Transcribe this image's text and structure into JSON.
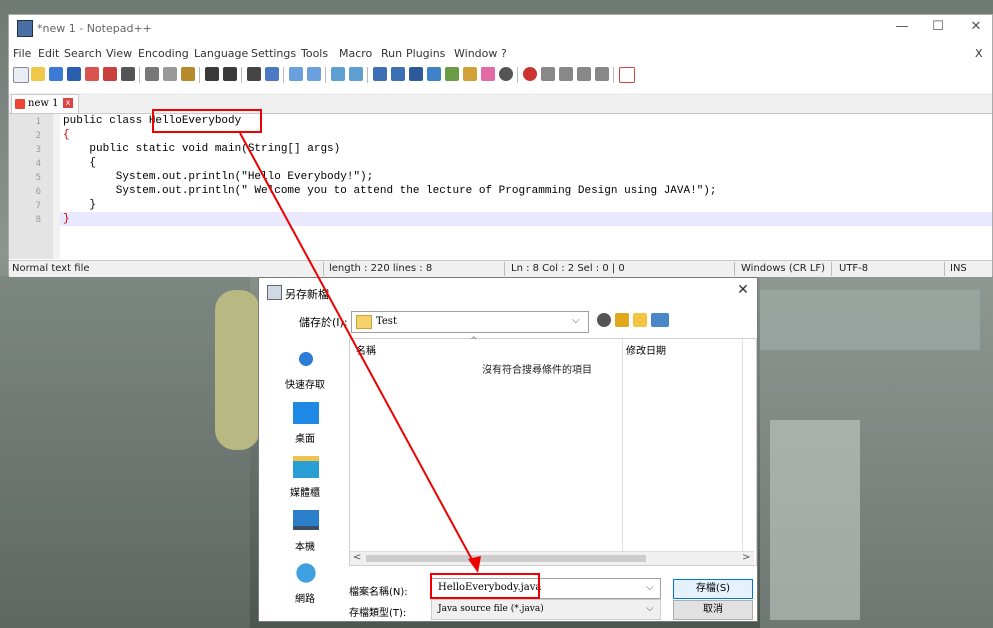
{
  "colors": {
    "annotation": "#e00000",
    "accent": "#0078d7"
  },
  "notepad": {
    "title": "*new 1 - Notepad++",
    "window_buttons": [
      "—",
      "☐",
      "✕"
    ],
    "menu_close": "X",
    "menus": [
      "File",
      "Edit",
      "Search",
      "View",
      "Encoding",
      "Language",
      "Settings",
      "Tools",
      "Macro",
      "Run",
      "Plugins",
      "Window",
      "?"
    ],
    "tab_label": "new 1",
    "line_numbers": [
      "1",
      "2",
      "3",
      "4",
      "5",
      "6",
      "7",
      "8"
    ],
    "code_lines": [
      "public class HelloEverybody",
      "{",
      "    public static void main(String[] args)",
      "    {",
      "        System.out.println(\"Hello Everybody!\");",
      "        System.out.println(\" Welcome you to attend the lecture of Programming Design using JAVA!\");",
      "    }",
      "}"
    ],
    "status": {
      "type": "Normal text file",
      "length": "length : 220   lines : 8",
      "pos": "Ln : 8   Col : 2   Sel : 0 | 0",
      "eol": "Windows (CR LF)",
      "enc": "UTF-8",
      "mode": "INS"
    }
  },
  "dialog": {
    "title": "另存新檔",
    "close": "✕",
    "save_in_label": "儲存於(I):",
    "save_in_value": "Test",
    "places": [
      "快速存取",
      "桌面",
      "媒體櫃",
      "本機",
      "網路"
    ],
    "col_name": "名稱",
    "col_date": "修改日期",
    "sort_caret": "^",
    "empty_message": "沒有符合搜尋條件的項目",
    "filename_label": "檔案名稱(N):",
    "filename_value": "HelloEverybody.java",
    "filetype_label": "存檔類型(T):",
    "filetype_value": "Java source file (*.java)",
    "save_button": "存檔(S)",
    "cancel_button": "取消"
  }
}
